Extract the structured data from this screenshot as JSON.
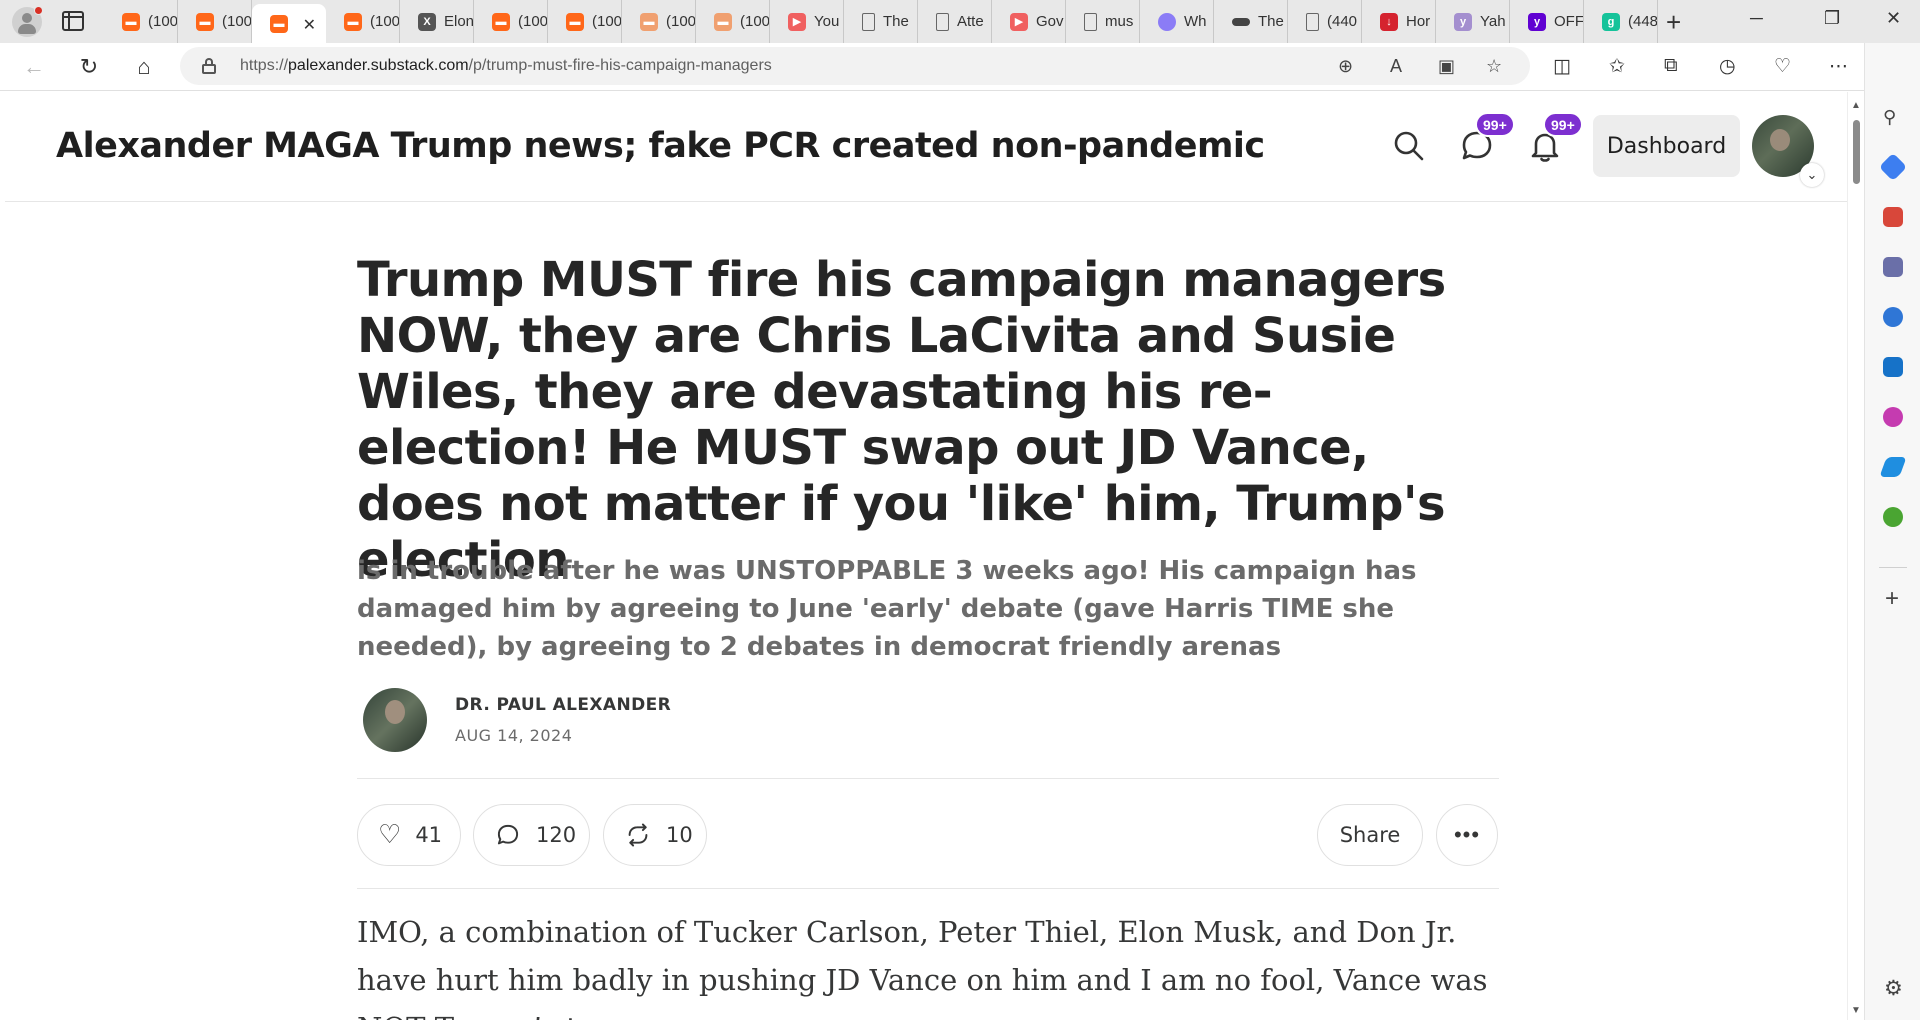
{
  "browser": {
    "tabs": [
      {
        "icon": "substack-icon",
        "title": "(100"
      },
      {
        "icon": "substack-icon",
        "title": "(100"
      },
      {
        "icon": "substack-icon",
        "title": "",
        "active": true
      },
      {
        "icon": "substack-icon",
        "title": "(100"
      },
      {
        "icon": "x-icon",
        "title": "Elon"
      },
      {
        "icon": "substack-icon",
        "title": "(100"
      },
      {
        "icon": "substack-icon",
        "title": "(100"
      },
      {
        "icon": "substack-icon",
        "title": "(100"
      },
      {
        "icon": "substack-icon",
        "title": "(100"
      },
      {
        "icon": "youtube-icon",
        "title": "You"
      },
      {
        "icon": "document-icon",
        "title": "The"
      },
      {
        "icon": "document-icon",
        "title": "Atte"
      },
      {
        "icon": "youtube-icon",
        "title": "Gov"
      },
      {
        "icon": "document-icon",
        "title": "mus"
      },
      {
        "icon": "proton-icon",
        "title": "Wh"
      },
      {
        "icon": "more-icon",
        "title": "The"
      },
      {
        "icon": "document-icon",
        "title": "(440"
      },
      {
        "icon": "red-app-icon",
        "title": "Hor"
      },
      {
        "icon": "yahoo-icon",
        "title": "Yah"
      },
      {
        "icon": "yahoo-icon",
        "title": "OFF"
      },
      {
        "icon": "grammarly-icon",
        "title": "(448"
      }
    ],
    "url_prefix": "https://",
    "url_domain": "palexander.substack.com",
    "url_path": "/p/trump-must-fire-his-campaign-managers"
  },
  "site": {
    "title": "Alexander MAGA Trump news; fake PCR created non-pandemic",
    "chat_badge": "99+",
    "notif_badge": "99+",
    "dashboard_label": "Dashboard"
  },
  "post": {
    "headline": "Trump MUST fire his campaign managers NOW, they are Chris LaCivita and Susie Wiles, they are devastating his re-election! He MUST swap out JD Vance, does not matter if you 'like' him, Trump's election",
    "subtitle": "is in trouble after he was UNSTOPPABLE 3 weeks ago! His campaign has damaged him by agreeing to June 'early' debate (gave Harris TIME she needed), by agreeing to 2 debates in democrat friendly arenas",
    "author": "DR. PAUL ALEXANDER",
    "date": "AUG 14, 2024",
    "likes": "41",
    "comments": "120",
    "restacks": "10",
    "share_label": "Share",
    "more_label": "•••",
    "body": "IMO, a combination of Tucker Carlson, Peter Thiel, Elon Musk, and Don Jr. have hurt him badly in pushing JD Vance on him and I am no fool, Vance was NOT Trump’s top"
  }
}
